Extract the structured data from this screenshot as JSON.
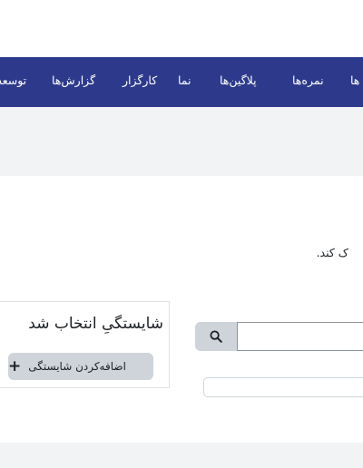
{
  "navbar": {
    "items": [
      {
        "label": "ها"
      },
      {
        "label": "نمره‌ها"
      },
      {
        "label": "پلاگین‌ها"
      },
      {
        "label": "نما"
      },
      {
        "label": "کارگزار"
      },
      {
        "label": "گزارش‌ها"
      },
      {
        "label": "توسعه"
      }
    ]
  },
  "main": {
    "intro_text": "ک کند.",
    "search": {
      "value": "",
      "placeholder": ""
    },
    "filter": {
      "value": "",
      "placeholder": ""
    },
    "card": {
      "title": "شایستگیِ انتخاب شد",
      "add_button_label": "اضافه‌کردن شایستگی"
    }
  },
  "icons": {
    "search": "search-icon",
    "plus": "plus-icon"
  },
  "colors": {
    "navbar": "#2d3a8c",
    "button": "#ced4da",
    "page_bg": "#f2f3f5"
  }
}
